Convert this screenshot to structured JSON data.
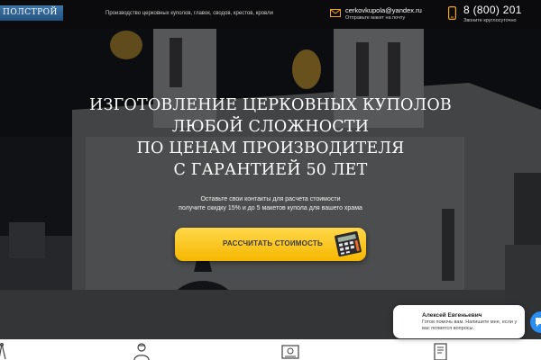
{
  "header": {
    "logo_text": "ПОЛСТРОЙ",
    "tagline": "Производство церковных куполов, главок, сводов, крестов, кровли",
    "email": "cerkovkupola@yandex.ru",
    "email_note": "Отправьте макет на почту",
    "phone": "8 (800) 201",
    "phone_note": "Звоните круглосуточно"
  },
  "hero": {
    "headline": [
      "ИЗГОТОВЛЕНИЕ ЦЕРКОВНЫХ КУПОЛОВ",
      "ЛЮБОЙ СЛОЖНОСТИ",
      "ПО ЦЕНАМ ПРОИЗВОДИТЕЛЯ",
      "С ГАРАНТИЕЙ 50 ЛЕТ"
    ],
    "subtext": [
      "Оставьте свои контакты для расчета стоимости",
      "получите скидку 15% и до 5 макетов купола для вашего храма"
    ],
    "cta_label": "РАССЧИТАТЬ СТОИМОСТЬ"
  },
  "chat": {
    "agent_name": "Алексей Евгеньевич",
    "message": "Готов помочь вам. Напишите мне, если у вас появятся вопросы."
  },
  "icons": {
    "mail": "mail-icon",
    "phone": "mobile-phone-icon",
    "calculator": "calculator-icon",
    "chat": "chat-icon"
  },
  "colors": {
    "header_bg": "#0b0b0d",
    "cta_yellow": "#f6b700",
    "accent_orange": "#f2a21a",
    "chat_blue": "#2a8ef0"
  }
}
